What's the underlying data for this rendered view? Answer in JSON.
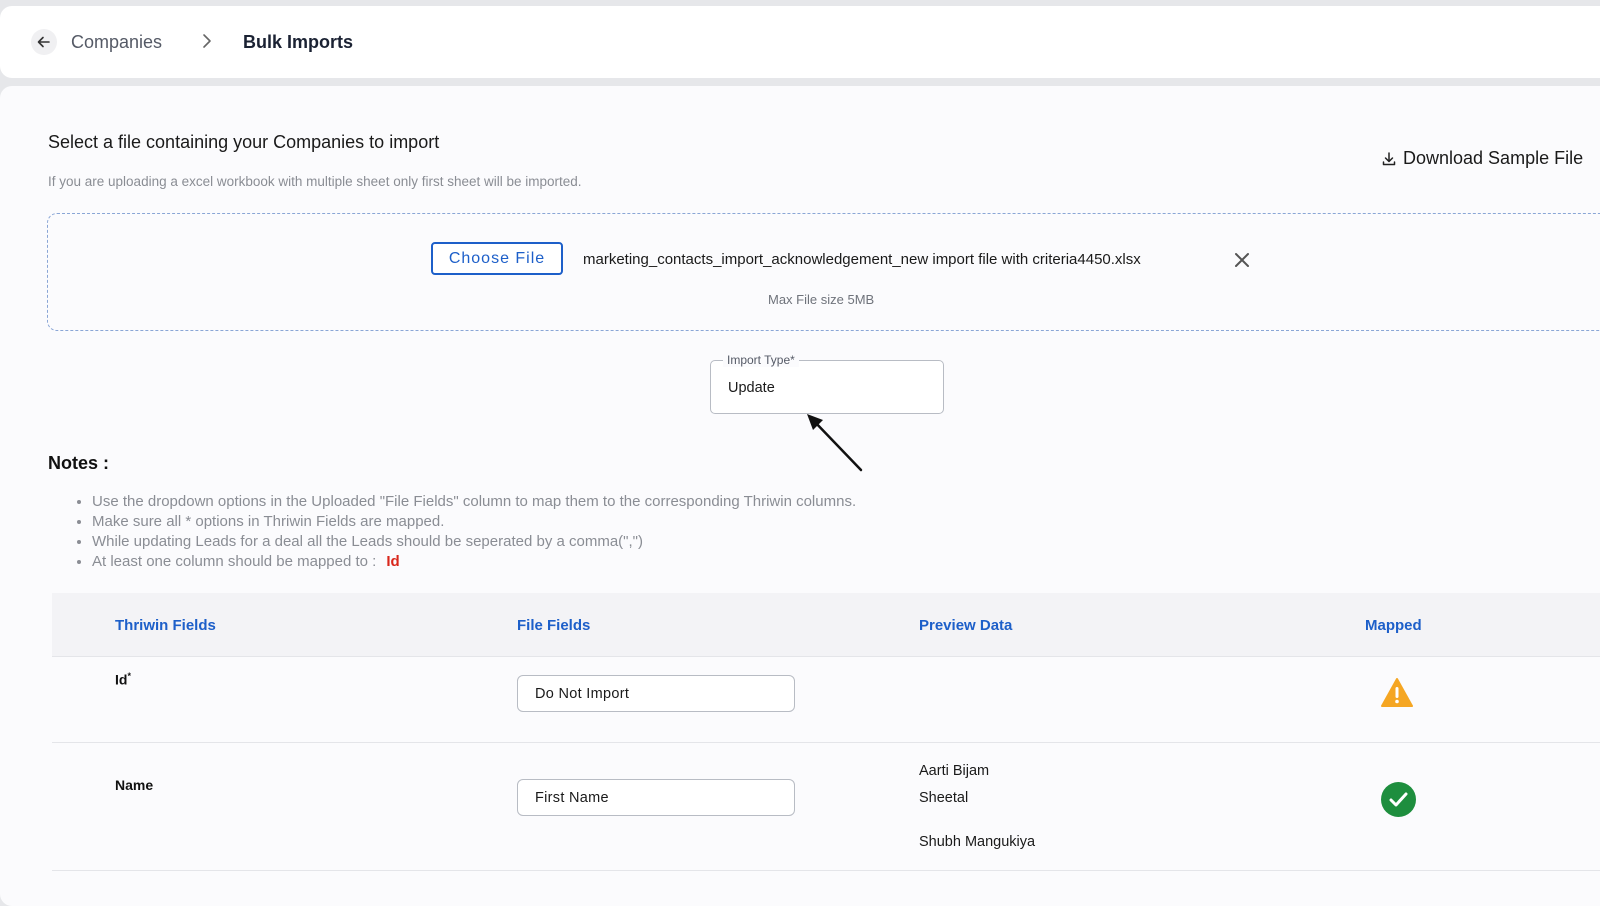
{
  "breadcrumb": {
    "parent": "Companies",
    "current": "Bulk Imports"
  },
  "upload": {
    "heading": "Select a file containing your Companies to import",
    "subheading": "If you are uploading a excel workbook with multiple sheet only first sheet will be imported.",
    "download_sample": "Download Sample File",
    "choose_file": "Choose File",
    "file_name": "marketing_contacts_import_acknowledgement_new import file with criteria4450.xlsx",
    "max_size": "Max File size 5MB"
  },
  "import_type": {
    "label": "Import Type*",
    "value": "Update"
  },
  "notes": {
    "title": "Notes :",
    "items": [
      "Use the dropdown options in the Uploaded \"File Fields\" column to map them to the corresponding Thriwin columns.",
      "Make sure all * options in Thriwin Fields are mapped.",
      "While updating Leads for a deal all the Leads should be seperated by a comma(\",\")",
      "At least one column should be mapped to :"
    ],
    "required_field": "Id"
  },
  "table": {
    "headers": [
      "Thriwin Fields",
      "File Fields",
      "Preview Data",
      "Mapped"
    ],
    "rows": [
      {
        "field": "Id",
        "required_mark": "*",
        "file_field": "Do Not Import",
        "preview": [],
        "mapped": "warning-icon"
      },
      {
        "field": "Name",
        "required_mark": "",
        "file_field": "First Name",
        "preview": [
          "Aarti Bijam",
          "Sheetal",
          "Shubh Mangukiya"
        ],
        "mapped": "check-icon"
      }
    ]
  },
  "colors": {
    "accent": "#1d5fc9",
    "warning": "#f5a623",
    "success": "#1e8e3e",
    "danger": "#d9271c"
  }
}
